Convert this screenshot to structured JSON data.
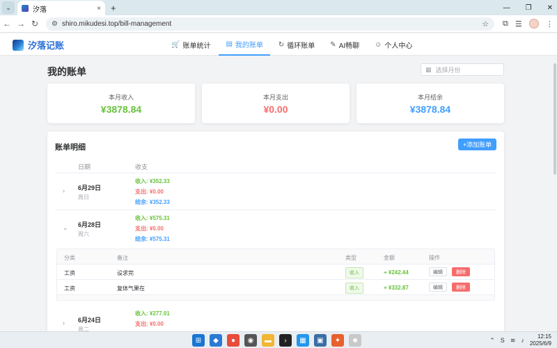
{
  "browser": {
    "tab_title": "汐落",
    "tab_close": "×",
    "new_tab": "+",
    "url": "shiro.mikudesi.top/bill-management",
    "win_min": "—",
    "win_max": "❐",
    "win_close": "✕"
  },
  "app": {
    "logo_text": "汐落记账",
    "nav": [
      {
        "icon": "cart-icon",
        "glyph": "🛒",
        "label": "账单统计"
      },
      {
        "icon": "document-icon",
        "glyph": "▤",
        "label": "我的账单"
      },
      {
        "icon": "refresh-icon",
        "glyph": "↻",
        "label": "循环账单"
      },
      {
        "icon": "pen-icon",
        "glyph": "✎",
        "label": "AI畅聊"
      },
      {
        "icon": "user-icon",
        "glyph": "☺",
        "label": "个人中心"
      }
    ]
  },
  "page": {
    "title": "我的账单",
    "month_placeholder": "选择月份"
  },
  "summary": {
    "income_label": "本月收入",
    "income_value": "¥3878.84",
    "expense_label": "本月支出",
    "expense_value": "¥0.00",
    "balance_label": "本月结余",
    "balance_value": "¥3878.84"
  },
  "colors": {
    "income": "#67c23a",
    "expense": "#f56c6c",
    "balance": "#409eff",
    "accent": "#409eff"
  },
  "detail": {
    "title": "账单明细",
    "add_button": "+添加账单",
    "col_date": "日期",
    "col_flow": "收支",
    "days": [
      {
        "date": "6月29日",
        "week": "周日",
        "income": "收入: ¥352.33",
        "expense": "支出: ¥0.00",
        "balance": "结余: ¥352.33",
        "expanded": false
      },
      {
        "date": "6月28日",
        "week": "周六",
        "income": "收入: ¥575.31",
        "expense": "支出: ¥0.00",
        "balance": "结余: ¥575.31",
        "expanded": true
      },
      {
        "date": "6月24日",
        "week": "周二",
        "income": "收入: ¥277.01",
        "expense": "支出: ¥0.00",
        "balance": "",
        "expanded": false
      }
    ],
    "sub_headers": {
      "category": "分类",
      "note": "备注",
      "type": "类型",
      "amount": "金额",
      "ops": "操作"
    },
    "sub_rows": [
      {
        "category": "工资",
        "note": "设求完",
        "type": "收入",
        "amount": "+ ¥242.44",
        "edit": "编辑",
        "delete": "删除"
      },
      {
        "category": "工资",
        "note": "复体气果在",
        "type": "收入",
        "amount": "+ ¥332.87",
        "edit": "编辑",
        "delete": "删除"
      }
    ]
  },
  "taskbar": {
    "time": "12:15",
    "date": "2025/6/9"
  }
}
